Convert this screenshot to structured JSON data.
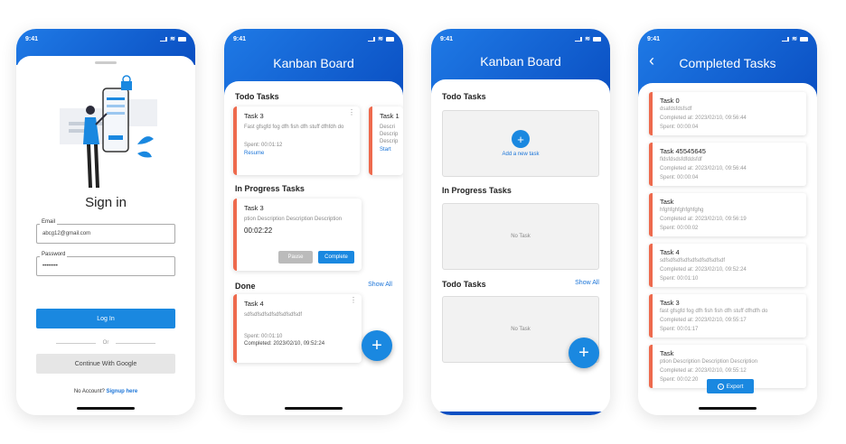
{
  "status_time": "9:41",
  "signin": {
    "title": "Sign in",
    "email_label": "Email",
    "email_value": "abcg12@gmail.com",
    "password_label": "Password",
    "password_value": "••••••••",
    "login_button": "Log In",
    "or_text": "Or",
    "google_button": "Continue With Google",
    "no_account": "No Account?",
    "signup_link": "Signup here"
  },
  "kanban1": {
    "title": "Kanban Board",
    "todo_heading": "Todo Tasks",
    "todo_card1": {
      "title": "Task 3",
      "desc": "Fast gfsgfd fog dfh fish dfh stuff dfhfdh do",
      "spent": "Spent: 00:01:12",
      "action": "Resume"
    },
    "todo_card2": {
      "title": "Task 1",
      "desc": "Descri Descrip Descrip",
      "action": "Start"
    },
    "progress_heading": "In Progress Tasks",
    "progress_card": {
      "title": "Task 3",
      "desc": "ption Description Description Description",
      "timer": "00:02:22",
      "pause": "Pause",
      "complete": "Complete"
    },
    "done_heading": "Done",
    "show_all": "Show All",
    "done_card": {
      "title": "Task 4",
      "desc": "sdfsdfsdfsdfsdfsdfsdfsdf",
      "spent": "Spent: 00:01:10",
      "completed": "Completed: 2023/02/10, 09:52:24"
    },
    "fab": "+"
  },
  "kanban2": {
    "title": "Kanban Board",
    "todo_heading": "Todo Tasks",
    "add_text": "Add a new task",
    "progress_heading": "In Progress Tasks",
    "no_task": "No Task",
    "todo_heading2": "Todo Tasks",
    "show_all": "Show All",
    "no_task2": "No Task",
    "fab": "+"
  },
  "completed": {
    "title": "Completed Tasks",
    "back": "‹",
    "export": "Export",
    "tasks": [
      {
        "name": "Task 0",
        "desc": "dsafdsfdsfsdf",
        "completed": "Completed at: 2023/02/10, 09:56:44",
        "spent": "Spent: 00:00:04"
      },
      {
        "name": "Task 45545645",
        "desc": "fldsfdsdsfdfddsfdf",
        "completed": "Completed at: 2023/02/10, 09:56:44",
        "spent": "Spent: 00:00:04"
      },
      {
        "name": "Task",
        "desc": "hfghfghfghfghfghg",
        "completed": "Completed at: 2023/02/10, 09:56:19",
        "spent": "Spent: 00:00:02"
      },
      {
        "name": "Task 4",
        "desc": "sdfsdfsdfsdfsdfsdfsdfsdfsdf",
        "completed": "Completed at: 2023/02/10, 09:52:24",
        "spent": "Spent: 00:01:10"
      },
      {
        "name": "Task 3",
        "desc": "fast gfsgfd fog dfh fish fish dfh stuff dfhdfh do",
        "completed": "Completed at: 2023/02/10, 09:55:17",
        "spent": "Spent: 00:01:17"
      },
      {
        "name": "Task",
        "desc": "ption Description Description Description",
        "completed": "Completed at: 2023/02/10, 09:55:12",
        "spent": "Spent: 00:02:20"
      }
    ]
  }
}
